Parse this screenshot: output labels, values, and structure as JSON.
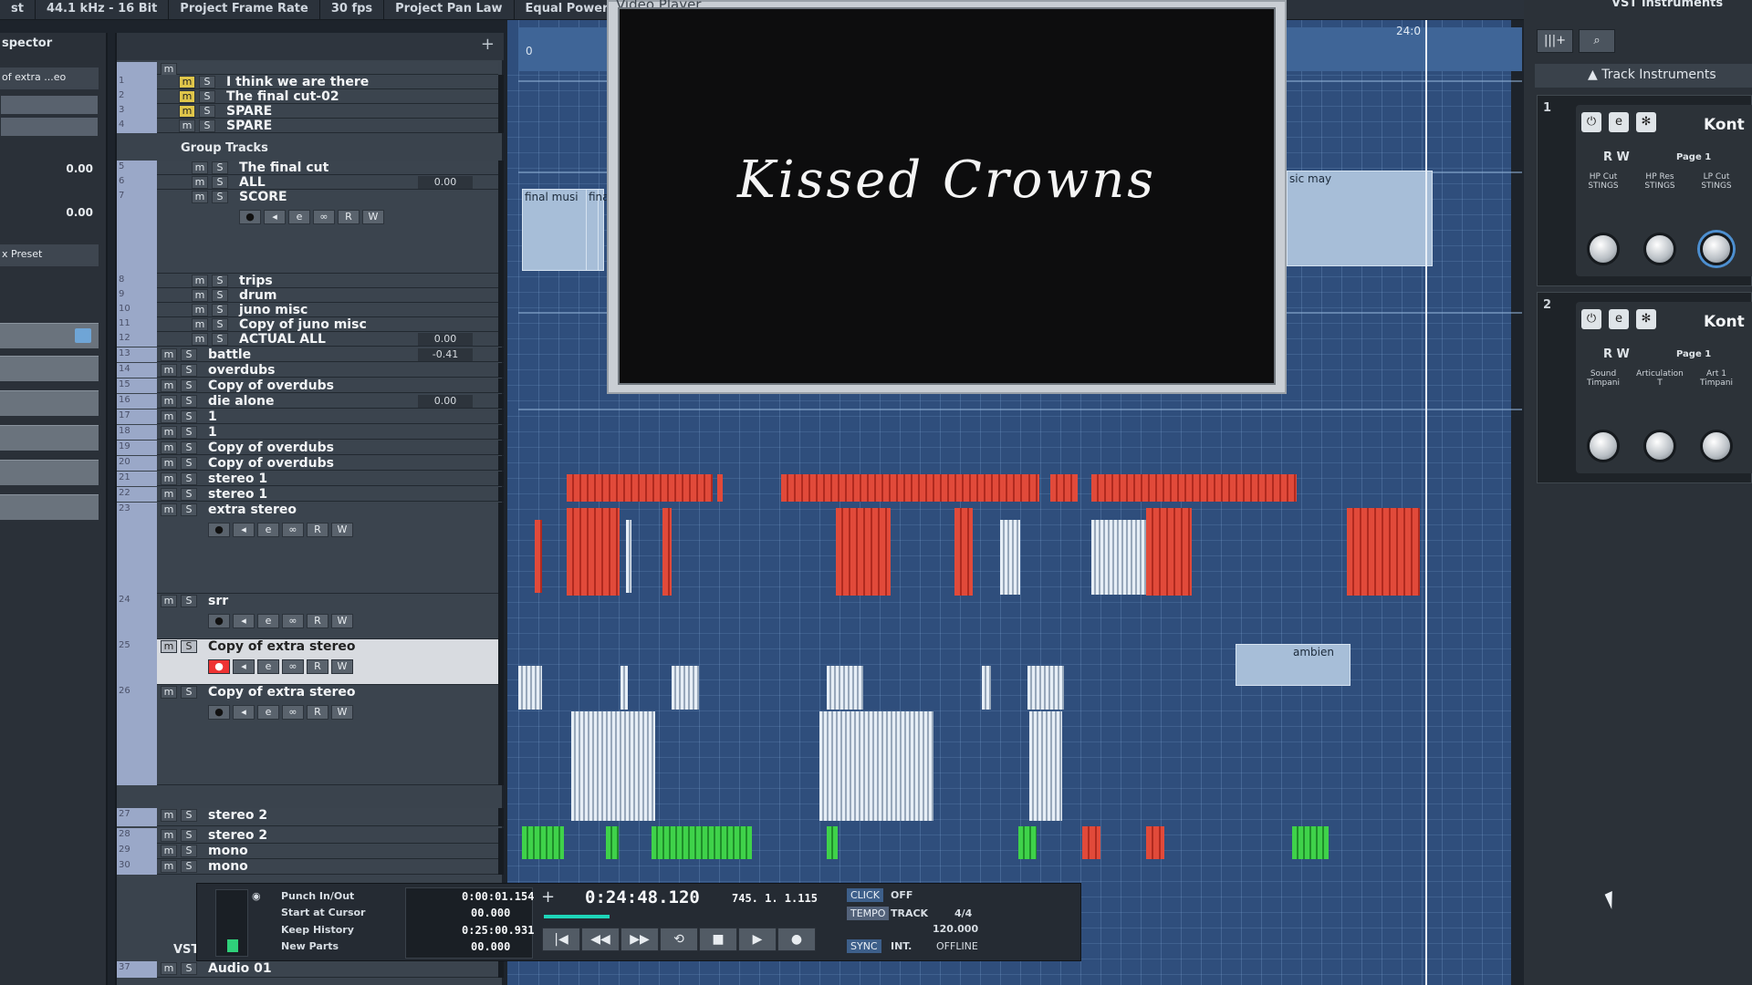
{
  "topbar": {
    "items": [
      "st",
      "44.1 kHz - 16 Bit",
      "Project Frame Rate",
      "30 fps",
      "Project Pan Law",
      "Equal Power"
    ]
  },
  "inspector": {
    "title": "spector",
    "preset_track": "of extra ...eo",
    "val_a": "0.00",
    "val_b": "0.00",
    "fx_preset": "x Preset"
  },
  "tracks": [
    {
      "n": "1",
      "name": "I think we are there",
      "m": "m",
      "s": "S",
      "mute_on": true
    },
    {
      "n": "2",
      "name": "The final cut-02",
      "m": "m",
      "s": "S",
      "mute_on": true
    },
    {
      "n": "3",
      "name": "SPARE",
      "m": "m",
      "s": "S",
      "mute_on": true
    },
    {
      "n": "4",
      "name": "SPARE",
      "m": "m",
      "s": "S",
      "mute_on": false
    },
    {
      "n": "5",
      "name": "The final cut",
      "m": "m",
      "s": "S"
    },
    {
      "n": "6",
      "name": "ALL",
      "m": "m",
      "s": "S",
      "vol": "0.00"
    },
    {
      "n": "7",
      "name": "SCORE",
      "m": "m",
      "s": "S"
    },
    {
      "n": "8",
      "name": "trips",
      "m": "m",
      "s": "S"
    },
    {
      "n": "9",
      "name": "drum",
      "m": "m",
      "s": "S"
    },
    {
      "n": "10",
      "name": "juno misc",
      "m": "m",
      "s": "S"
    },
    {
      "n": "11",
      "name": "Copy of juno misc",
      "m": "m",
      "s": "S"
    },
    {
      "n": "12",
      "name": "ACTUAL ALL",
      "m": "m",
      "s": "S",
      "vol": "0.00"
    },
    {
      "n": "13",
      "name": "battle",
      "m": "m",
      "s": "S",
      "vol": "-0.41"
    },
    {
      "n": "14",
      "name": "overdubs",
      "m": "m",
      "s": "S"
    },
    {
      "n": "15",
      "name": "Copy of overdubs",
      "m": "m",
      "s": "S"
    },
    {
      "n": "16",
      "name": "die alone",
      "m": "m",
      "s": "S",
      "vol": "0.00"
    },
    {
      "n": "17",
      "name": "1",
      "m": "m",
      "s": "S"
    },
    {
      "n": "18",
      "name": "1",
      "m": "m",
      "s": "S"
    },
    {
      "n": "19",
      "name": "Copy of overdubs",
      "m": "m",
      "s": "S"
    },
    {
      "n": "20",
      "name": "Copy of overdubs",
      "m": "m",
      "s": "S"
    },
    {
      "n": "21",
      "name": "stereo 1",
      "m": "m",
      "s": "S"
    },
    {
      "n": "22",
      "name": "stereo 1",
      "m": "m",
      "s": "S"
    },
    {
      "n": "23",
      "name": "extra stereo",
      "m": "m",
      "s": "S"
    },
    {
      "n": "24",
      "name": "srr",
      "m": "m",
      "s": "S"
    },
    {
      "n": "25",
      "name": "Copy of extra stereo",
      "m": "m",
      "s": "S"
    },
    {
      "n": "26",
      "name": "Copy of extra stereo",
      "m": "m",
      "s": "S"
    },
    {
      "n": "27",
      "name": "stereo 2",
      "m": "m",
      "s": "S"
    },
    {
      "n": "28",
      "name": "stereo 2",
      "m": "m",
      "s": "S"
    },
    {
      "n": "29",
      "name": "mono",
      "m": "m",
      "s": "S"
    },
    {
      "n": "30",
      "name": "mono",
      "m": "m",
      "s": "S"
    },
    {
      "n": "37",
      "name": "Audio 01",
      "m": "m",
      "s": "S"
    }
  ],
  "group_tracks_label": "Group Tracks",
  "top_track_m": "m",
  "vst_label": "VST",
  "track_controls": {
    "r": "R",
    "w": "W",
    "e": "e",
    "rec": "●"
  },
  "arrange": {
    "clip_labels": [
      "final musi",
      "fina",
      "sic may",
      "ambien"
    ],
    "ruler_start": "0",
    "ruler_end": "24:0"
  },
  "video": {
    "title": "Video Player",
    "caption": "Kissed Crowns"
  },
  "transport": {
    "punch": "Punch In/Out",
    "start_cursor": "Start at Cursor",
    "keep_history": "Keep History",
    "new_parts": "New Parts",
    "left_locator": "0:00:01.154",
    "pre_roll": "00.000",
    "right_locator": "0:25:00.931",
    "post_roll": "00.000",
    "main_time": "0:24:48.120",
    "bars": "745. 1. 1.115",
    "click_label": "CLICK",
    "click_value": "OFF",
    "tempo_label": "TEMPO",
    "tempo_mode": "TRACK",
    "signature": "4/4",
    "tempo": "120.000",
    "sync_label": "SYNC",
    "sync_mode": "INT.",
    "sync_state": "OFFLINE",
    "plus": "+",
    "btn_start": "|◀",
    "btn_end": "▶|",
    "btn_rew": "◀◀",
    "btn_ff": "▶▶",
    "btn_cycle": "⟲",
    "btn_stop": "■",
    "btn_play": "▶",
    "btn_rec": "●",
    "progress": 0.55
  },
  "vst": {
    "title": "VST Instruments",
    "btn_add": "|||+",
    "btn_search": "⌕",
    "track_instruments": "Track Instruments",
    "instruments": [
      {
        "idx": "1",
        "name": "Kont",
        "rw": "R   W",
        "page": "Page 1",
        "labels": [
          "HP Cut STINGS",
          "HP Res STINGS",
          "LP Cut STINGS"
        ]
      },
      {
        "idx": "2",
        "name": "Kont",
        "rw": "R   W",
        "page": "Page 1",
        "labels": [
          "Sound Timpani",
          "Articulation T",
          "Art 1 Timpani"
        ]
      }
    ],
    "icons": {
      "power": "⏻",
      "edit": "e",
      "settings": "✻"
    }
  }
}
